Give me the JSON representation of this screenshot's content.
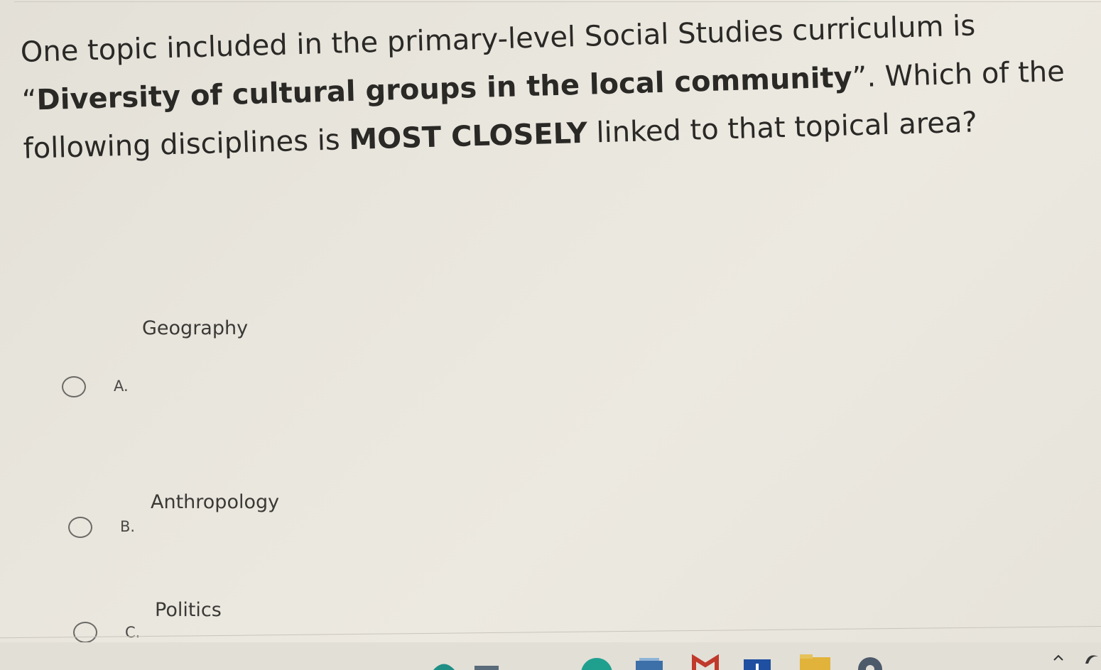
{
  "question": {
    "part1": "One topic included in the primary-level Social Studies curriculum is “",
    "bold1": "Diversity of cultural groups in the local community",
    "part2": "”. Which of the following disciplines is ",
    "bold2": "MOST CLOSELY",
    "part3": " linked to that topical area?"
  },
  "options": [
    {
      "letter": "A.",
      "text": "Geography"
    },
    {
      "letter": "B.",
      "text": "Anthropology"
    },
    {
      "letter": "C.",
      "text": "Politics"
    }
  ],
  "taskbar": {
    "icons": [
      "teal-app-icon",
      "mail-icon",
      "word-icon",
      "file-explorer-icon",
      "settings-icon"
    ],
    "tray": [
      "chevron-up-icon",
      "edge-icon"
    ],
    "colors": {
      "teal": "#1f8f86",
      "mail": "#8a1f3a",
      "word": "#1f4fa0",
      "folder": "#e2b33a",
      "settings": "#4d5a6a"
    }
  }
}
